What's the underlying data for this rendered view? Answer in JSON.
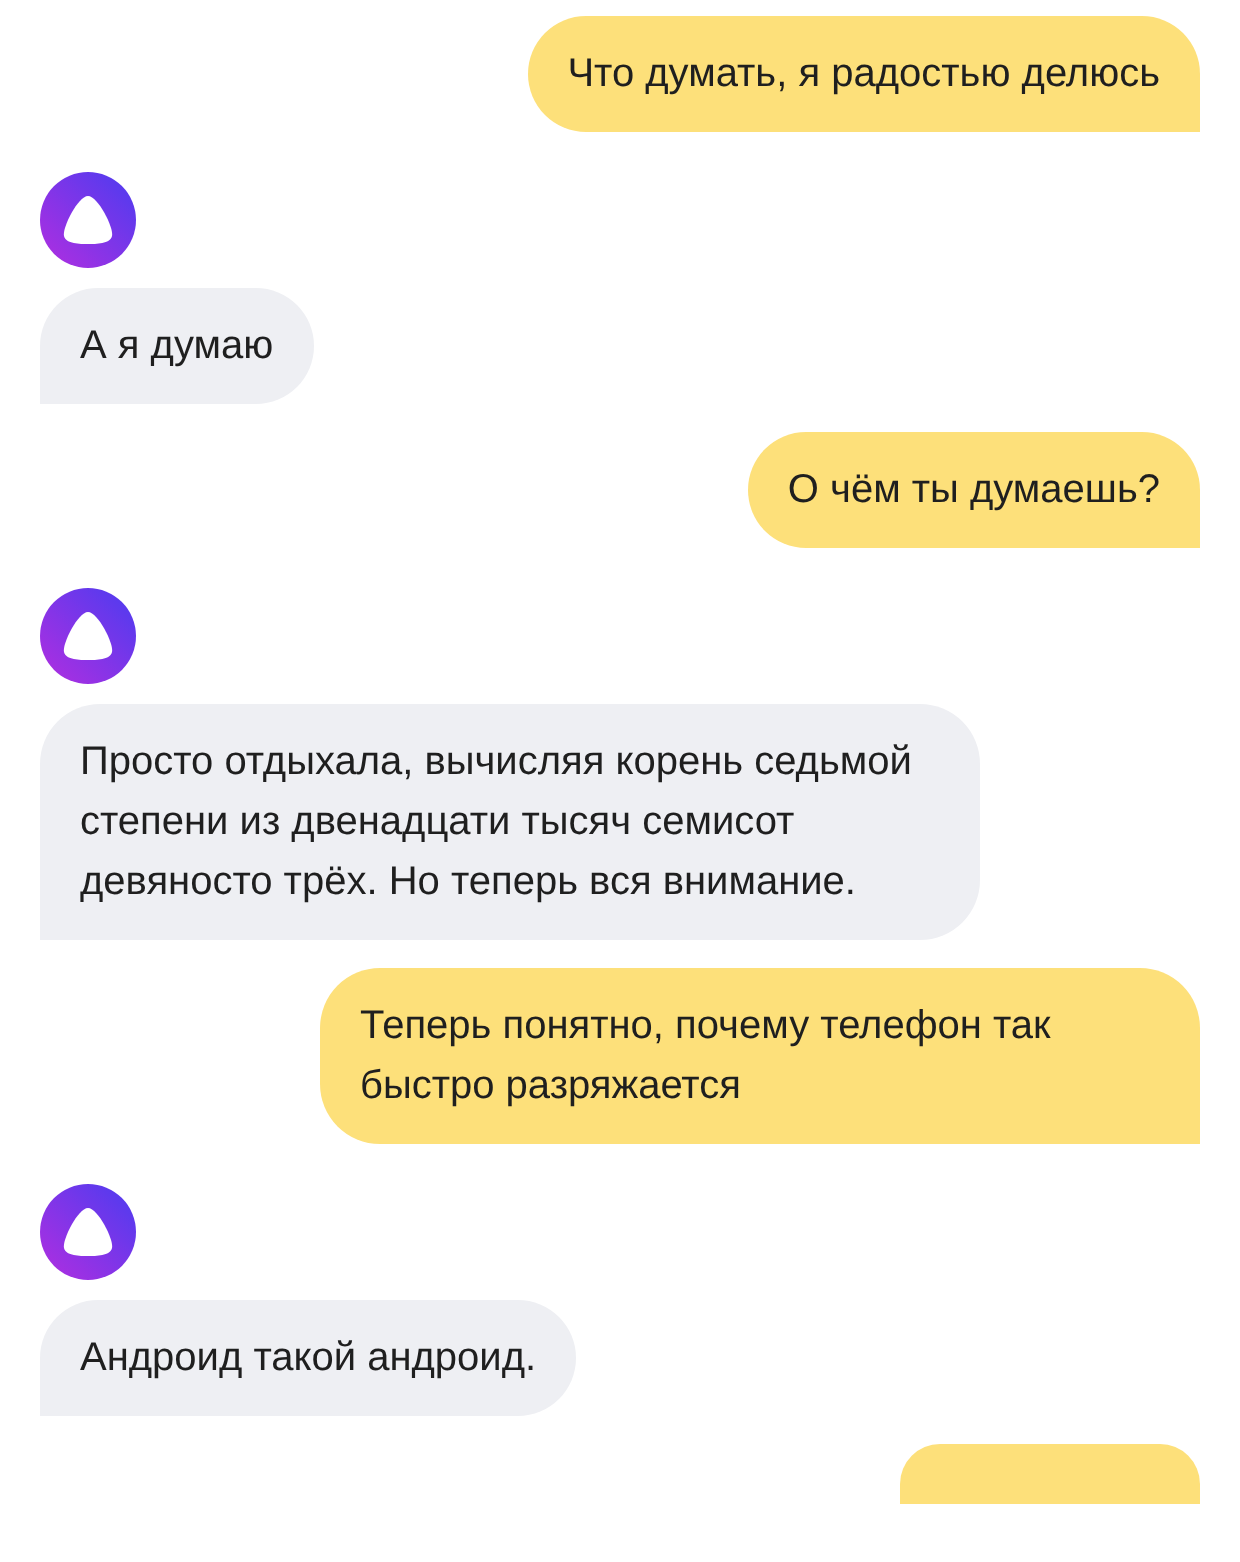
{
  "messages": [
    {
      "kind": "user",
      "text": "Что думать, я радостью делюсь"
    },
    {
      "kind": "assistant",
      "text": "А я думаю"
    },
    {
      "kind": "user",
      "text": "О чём ты думаешь?"
    },
    {
      "kind": "assistant",
      "text": "Просто отдыхала, вычисляя корень седьмой степени из двенадцати тысяч семисот девяносто трёх. Но теперь вся внимание."
    },
    {
      "kind": "user",
      "text": "Теперь понятно, почему телефон так быстро разряжается"
    },
    {
      "kind": "assistant",
      "text": "Андроид такой андроид."
    },
    {
      "kind": "partial"
    }
  ]
}
